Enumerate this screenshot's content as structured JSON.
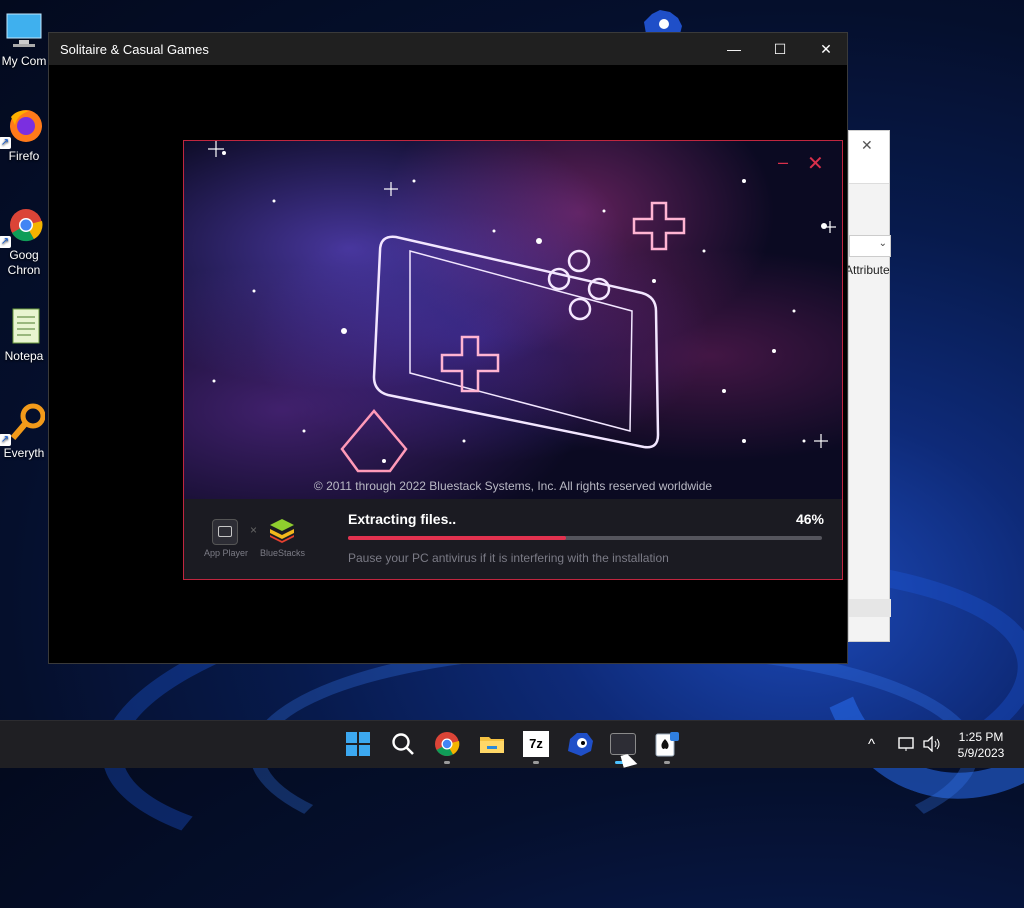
{
  "desktop": {
    "icons": [
      {
        "label": "My Com",
        "icon": "computer-icon"
      },
      {
        "label": "Firefo",
        "icon": "firefox-icon"
      },
      {
        "label": "Goog",
        "label2": "Chron",
        "icon": "chrome-icon"
      },
      {
        "label": "Notepa",
        "icon": "notepad-icon"
      },
      {
        "label": "Everyth",
        "icon": "everything-icon"
      }
    ]
  },
  "background_window": {
    "column_label": "Attribute"
  },
  "window": {
    "title": "Solitaire & Casual Games",
    "minimize": "—",
    "maximize": "☐",
    "close": "✕"
  },
  "installer": {
    "copyright": "© 2011 through 2022 Bluestack Systems, Inc. All rights reserved worldwide",
    "app_player_label": "App Player",
    "bluestacks_label": "BlueStacks",
    "separator": "×",
    "status": "Extracting files..",
    "progress_text": "46%",
    "progress_fraction": 0.46,
    "hint": "Pause your PC antivirus if it is interfering with the installation",
    "accent_color": "#e2324f"
  },
  "taskbar": {
    "apps": [
      {
        "name": "start-button",
        "icon": "windows-logo-icon"
      },
      {
        "name": "search-button",
        "icon": "search-icon"
      },
      {
        "name": "chrome",
        "icon": "chrome-icon"
      },
      {
        "name": "file-explorer",
        "icon": "folder-icon"
      },
      {
        "name": "7zip",
        "icon": "7zip-icon",
        "label": "7z"
      },
      {
        "name": "sonic",
        "icon": "sonic-icon"
      },
      {
        "name": "bluestacks",
        "icon": "bluestacks-app-player-icon"
      },
      {
        "name": "solitaire",
        "icon": "solitaire-icon"
      }
    ],
    "tray": {
      "chevron": "^",
      "time": "1:25 PM",
      "date": "5/9/2023"
    }
  }
}
